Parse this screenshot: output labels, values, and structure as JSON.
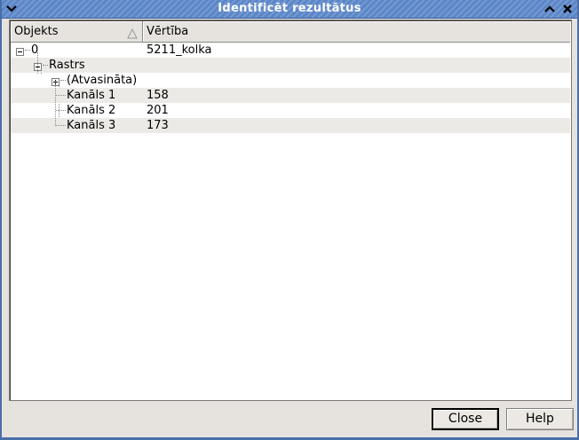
{
  "window": {
    "title": "Identificēt rezultātus"
  },
  "tree": {
    "columns": [
      "Objekts",
      "Vērtība"
    ],
    "rows": [
      {
        "name": "0",
        "value": "5211_kolka"
      },
      {
        "name": "Rastrs",
        "value": ""
      },
      {
        "name": "(Atvasināta)",
        "value": ""
      },
      {
        "name": "Kanāls 1",
        "value": "158"
      },
      {
        "name": "Kanāls 2",
        "value": "201"
      },
      {
        "name": "Kanāls 3",
        "value": "173"
      }
    ]
  },
  "buttons": {
    "close": "Close",
    "help": "Help"
  },
  "colors": {
    "titlebar": "#5b86c8",
    "alt_row": "#ebeae6",
    "dialog_bg": "#e6e3df"
  }
}
